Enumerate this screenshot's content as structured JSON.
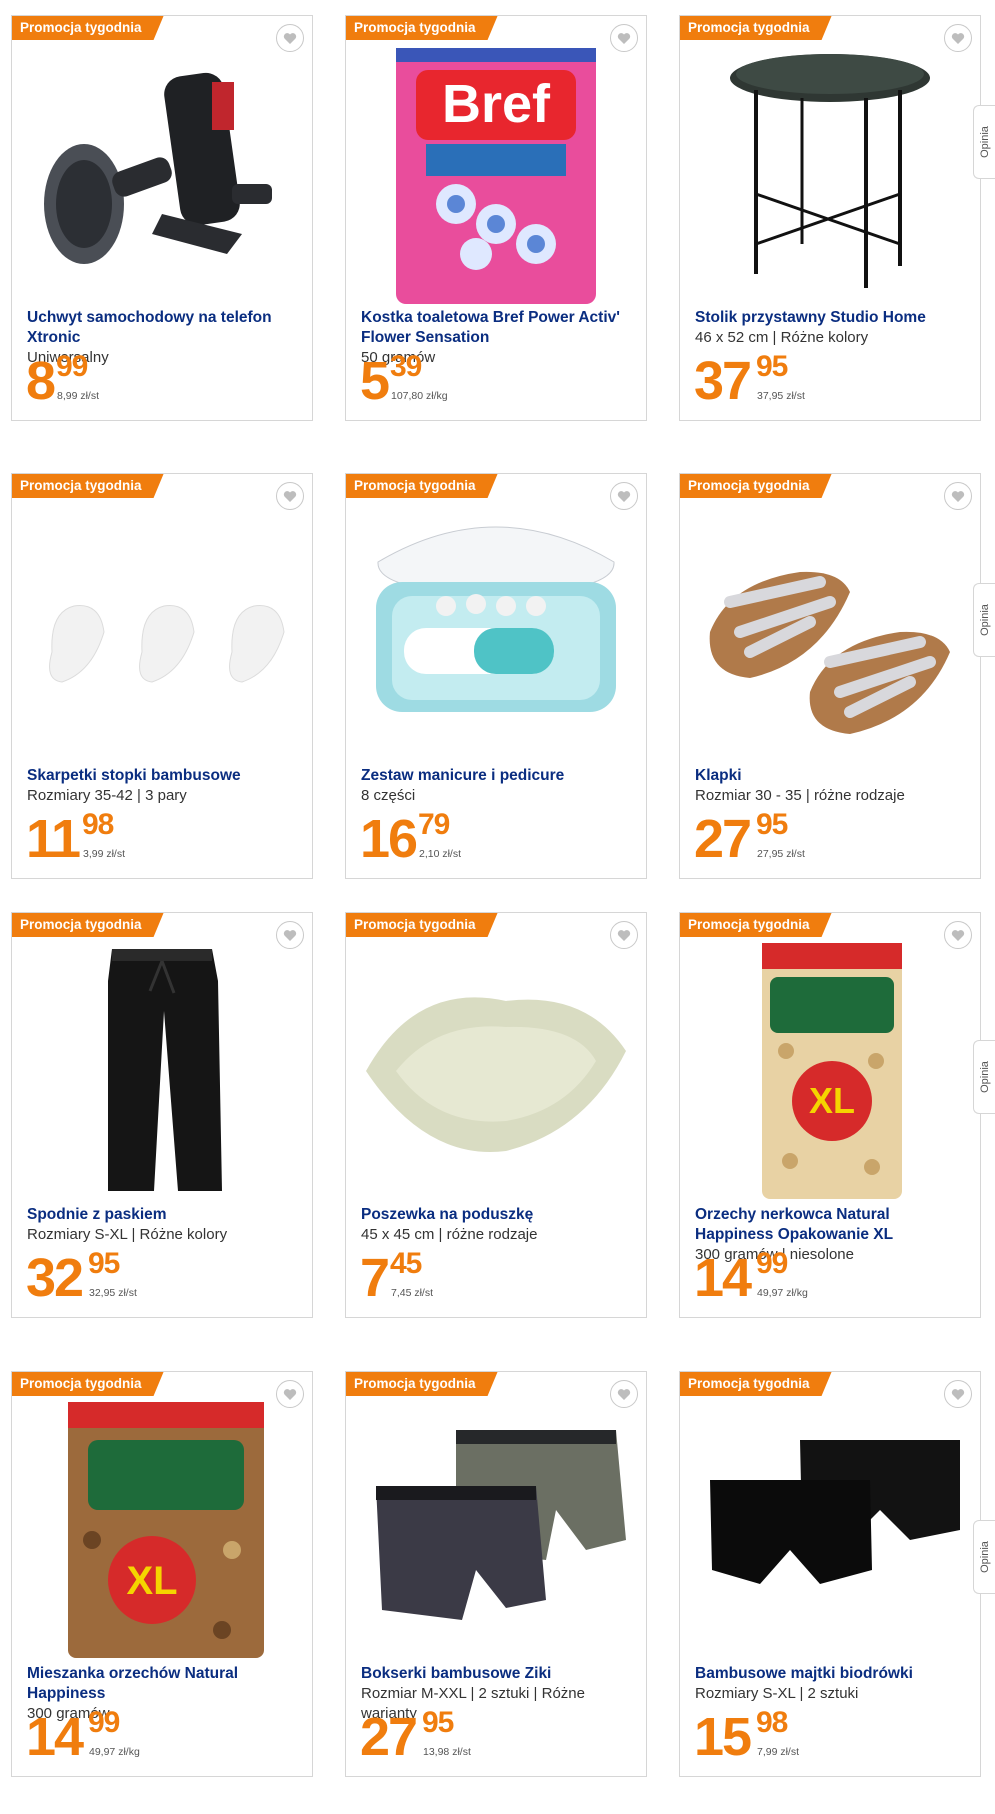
{
  "promo_label": "Promocja tygodnia",
  "opinia_label": "Opinia",
  "colors": {
    "accent": "#f07d0e",
    "title": "#0a2d80"
  },
  "products": [
    {
      "name": "Uchwyt samochodowy na telefon Xtronic",
      "sub": "Uniwersalny",
      "price_int": "8",
      "price_dec": "99",
      "unit": "8,99 zł/st",
      "icon": "phone-holder-icon"
    },
    {
      "name": "Kostka toaletowa Bref Power Activ' Flower Sensation",
      "sub": "50 gramów",
      "price_int": "5",
      "price_dec": "39",
      "unit": "107,80 zł/kg",
      "icon": "toilet-block-icon"
    },
    {
      "name": "Stolik przystawny Studio Home",
      "sub": "46 x 52 cm | Różne kolory",
      "price_int": "37",
      "price_dec": "95",
      "unit": "37,95 zł/st",
      "icon": "side-table-icon"
    },
    {
      "name": "Skarpetki stopki bambusowe",
      "sub": "Rozmiary 35-42 | 3 pary",
      "price_int": "11",
      "price_dec": "98",
      "unit": "3,99 zł/st",
      "icon": "socks-icon"
    },
    {
      "name": "Zestaw manicure i pedicure",
      "sub": "8 części",
      "price_int": "16",
      "price_dec": "79",
      "unit": "2,10 zł/st",
      "icon": "manicure-set-icon"
    },
    {
      "name": "Klapki",
      "sub": "Rozmiar 30 - 35 | różne rodzaje",
      "price_int": "27",
      "price_dec": "95",
      "unit": "27,95 zł/st",
      "icon": "sandals-icon"
    },
    {
      "name": "Spodnie z paskiem",
      "sub": "Rozmiary S-XL | Różne kolory",
      "price_int": "32",
      "price_dec": "95",
      "unit": "32,95 zł/st",
      "icon": "trousers-icon"
    },
    {
      "name": "Poszewka na poduszkę",
      "sub": "45 x 45 cm | różne rodzaje",
      "price_int": "7",
      "price_dec": "45",
      "unit": "7,45 zł/st",
      "icon": "pillow-icon"
    },
    {
      "name": "Orzechy nerkowca Natural Happiness Opakowanie XL",
      "sub": "300 gramów | niesolone",
      "price_int": "14",
      "price_dec": "99",
      "unit": "49,97 zł/kg",
      "icon": "cashew-bag-icon"
    },
    {
      "name": "Mieszanka orzechów Natural Happiness",
      "sub": "300 gramów",
      "price_int": "14",
      "price_dec": "99",
      "unit": "49,97 zł/kg",
      "icon": "nut-mix-bag-icon"
    },
    {
      "name": "Bokserki bambusowe Ziki",
      "sub": "Rozmiar M-XXL | 2 sztuki | Różne warianty",
      "price_int": "27",
      "price_dec": "95",
      "unit": "13,98 zł/st",
      "icon": "boxers-icon"
    },
    {
      "name": "Bambusowe majtki biodrówki",
      "sub": "Rozmiary S-XL | 2 sztuki",
      "price_int": "15",
      "price_dec": "98",
      "unit": "7,99 zł/st",
      "icon": "briefs-icon"
    }
  ]
}
